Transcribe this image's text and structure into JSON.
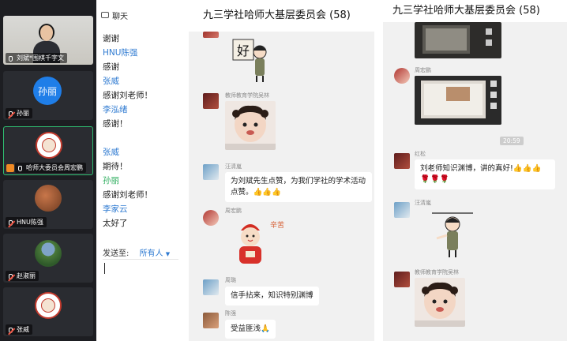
{
  "meeting": {
    "participants": [
      {
        "name": "刘斌*围棋千字文",
        "avatar": "video"
      },
      {
        "name": "孙丽",
        "avatar_text": "孙丽"
      },
      {
        "name": "哈师大委员会周宏鹏",
        "avatar": "seal"
      },
      {
        "name": "HNU陈强",
        "avatar": "photo"
      },
      {
        "name": "赵淑丽",
        "avatar": "photo"
      },
      {
        "name": "张威",
        "avatar": "seal"
      }
    ],
    "chat": {
      "title": "聊天",
      "lines": [
        {
          "type": "msg",
          "text": "谢谢"
        },
        {
          "type": "sender",
          "text": "HNU陈强"
        },
        {
          "type": "msg",
          "text": "感谢"
        },
        {
          "type": "sender",
          "text": "张威"
        },
        {
          "type": "msg",
          "text": "感谢刘老师！"
        },
        {
          "type": "sender",
          "text": "李泓绪"
        },
        {
          "type": "msg",
          "text": "感谢！"
        },
        {
          "type": "sender",
          "text": "张威"
        },
        {
          "type": "msg",
          "text": "期待！"
        },
        {
          "type": "sender-green",
          "text": "孙丽"
        },
        {
          "type": "msg",
          "text": "感谢刘老师！"
        },
        {
          "type": "sender",
          "text": "李家云"
        },
        {
          "type": "msg",
          "text": "太好了"
        }
      ],
      "send_to_label": "发送至:",
      "send_to_target": "所有人"
    }
  },
  "group_a": {
    "title": "九三学社哈师大基层委员会 (58)",
    "messages": [
      {
        "nick": "",
        "kind": "sticker",
        "sticker_text": "好"
      },
      {
        "nick": "教师教育学院吴林",
        "kind": "image"
      },
      {
        "nick": "汪清嵐",
        "kind": "text",
        "text": "为刘斌先生点赞，为我们学社的学术活动点赞。",
        "emoji": "👍👍👍"
      },
      {
        "nick": "周宏鹏",
        "kind": "sticker",
        "sticker_text": "辛苦"
      },
      {
        "nick": "周璐",
        "kind": "text",
        "text": "信手拈来，知识特别渊博",
        "emoji": ""
      },
      {
        "nick": "陈强",
        "kind": "text",
        "text": "受益匪浅",
        "emoji": "🙏"
      }
    ]
  },
  "group_b": {
    "title": "九三学社哈师大基层委员会 (58)",
    "messages": [
      {
        "nick": "",
        "kind": "image"
      },
      {
        "nick": "周宏鹏",
        "kind": "image"
      },
      {
        "time": "20:59"
      },
      {
        "nick": "红松",
        "kind": "text",
        "text": "刘老师知识渊博，讲的真好!",
        "emoji": "👍👍👍",
        "flowers": "🌹🌹🌹"
      },
      {
        "nick": "汪清嵐",
        "kind": "sticker"
      },
      {
        "nick": "教师教育学院吴林",
        "kind": "image"
      }
    ]
  }
}
